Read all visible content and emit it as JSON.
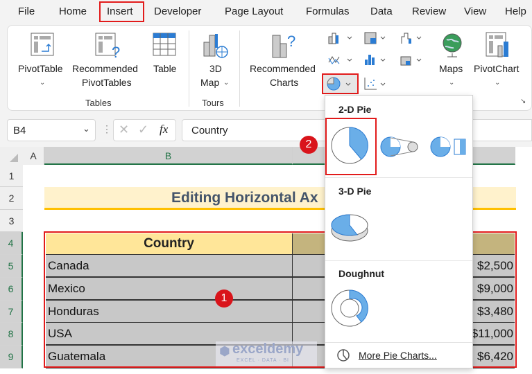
{
  "menu": {
    "tabs": [
      "File",
      "Home",
      "Insert",
      "Developer",
      "Page Layout",
      "Formulas",
      "Data",
      "Review",
      "View",
      "Help"
    ],
    "active": "Insert"
  },
  "ribbon": {
    "pivottable": "PivotTable",
    "rec_pivot_1": "Recommended",
    "rec_pivot_2": "PivotTables",
    "table": "Table",
    "map_1": "3D",
    "map_2": "Map",
    "rec_charts_1": "Recommended",
    "rec_charts_2": "Charts",
    "maps": "Maps",
    "pivotchart": "PivotChart",
    "groups": {
      "tables": "Tables",
      "tours": "Tours"
    }
  },
  "formula_bar": {
    "name_box": "B4",
    "fx": "fx",
    "value": "Country"
  },
  "sheet": {
    "columns": [
      "A",
      "B"
    ],
    "rows": [
      "1",
      "2",
      "3",
      "4",
      "5",
      "6",
      "7",
      "8",
      "9"
    ],
    "title": "Editing Horizontal Ax",
    "header": "Country",
    "countries": [
      "Canada",
      "Mexico",
      "Honduras",
      "USA",
      "Guatemala"
    ],
    "values": [
      "$2,500",
      "$9,000",
      "$3,480",
      "$11,000",
      "$6,420"
    ]
  },
  "pie_dropdown": {
    "section_2d": "2-D Pie",
    "section_3d": "3-D Pie",
    "section_doughnut": "Doughnut",
    "more": "More Pie Charts..."
  },
  "badges": {
    "step1": "1",
    "step2": "2"
  },
  "watermark": {
    "name": "exceldemy",
    "tagline": "EXCEL · DATA · BI"
  },
  "colors": {
    "accent": "#e21b1b",
    "header_fill": "#ffe699",
    "title_fill": "#fff2cc",
    "title_underline": "#ffc000",
    "selection": "#c8c8c8",
    "pie_blue": "#6aaee8",
    "excel_green": "#217346"
  }
}
